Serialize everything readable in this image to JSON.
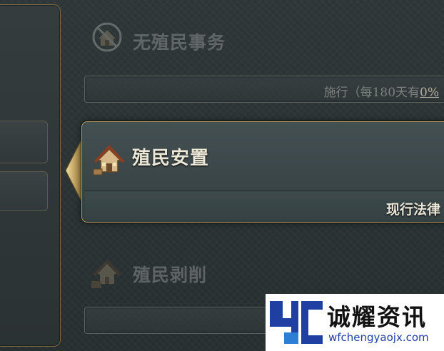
{
  "policies": {
    "no_colony_affairs": {
      "title": "无殖民事务",
      "bar_text_prefix": "施行（每180天有",
      "bar_text_value": "0%",
      "icon": "house-crossed-icon"
    },
    "colonial_settlement": {
      "title": "殖民安置",
      "status": "现行法律",
      "icon": "house-settlement-icon"
    },
    "colonial_exploitation": {
      "title": "殖民剥削",
      "icon": "house-exploitation-icon"
    }
  },
  "watermark": {
    "name": "诚耀资讯",
    "url": "wfchengyaojx.com"
  },
  "colors": {
    "gold_border": "#b69a5c",
    "card_bg": "#3b4649",
    "text_light": "#ece7d6",
    "watermark_blue": "#1f3fa3"
  }
}
